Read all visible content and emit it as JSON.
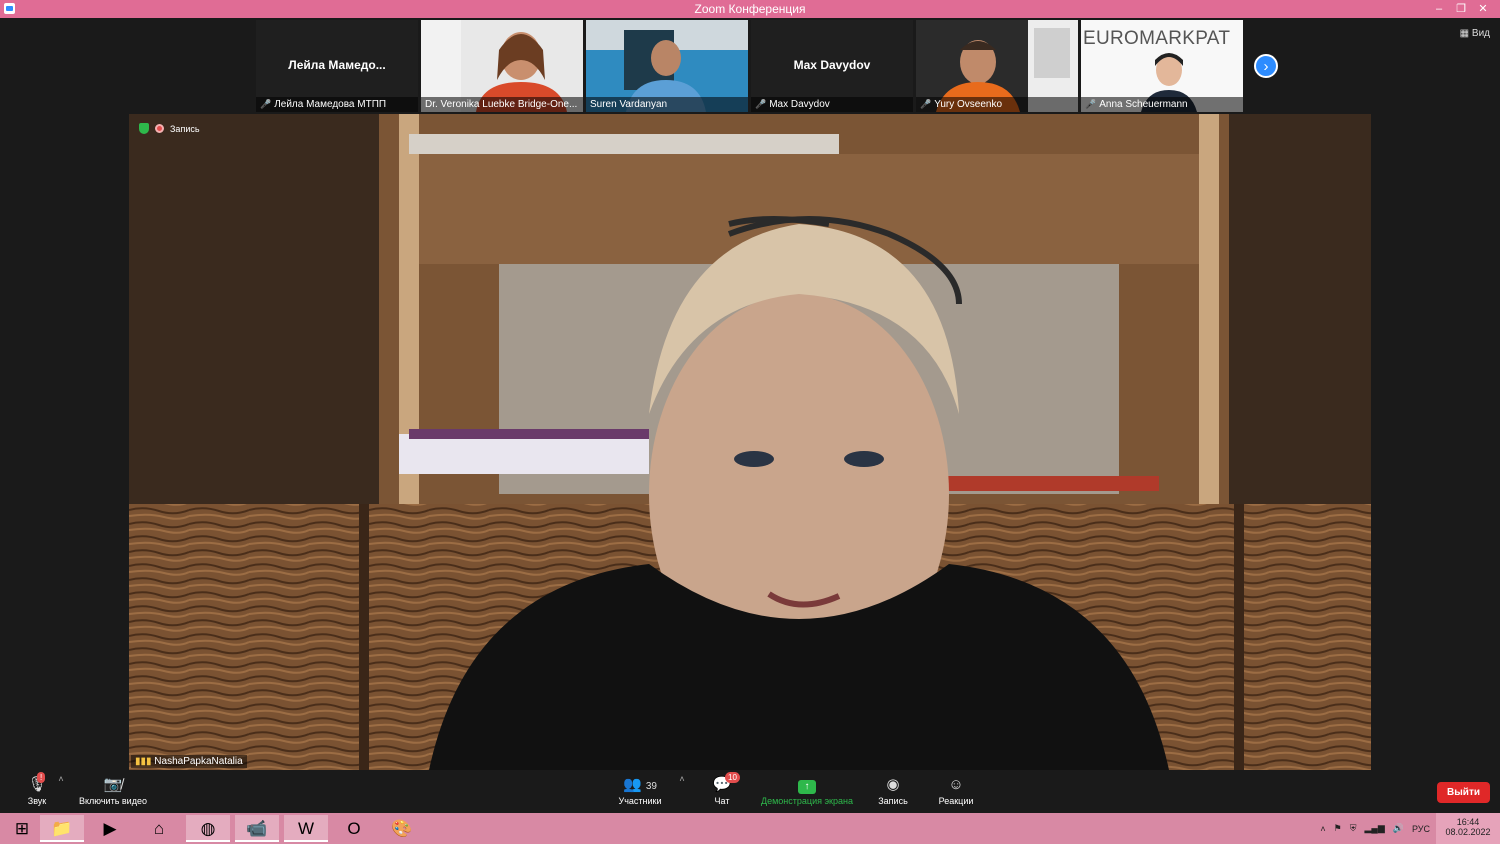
{
  "window": {
    "title": "Zoom Конференция",
    "min": "–",
    "restore": "❐",
    "close": "✕"
  },
  "view_button": "▦ Вид",
  "participants_strip": [
    {
      "display": "Лейла  Мамедо...",
      "label": "Лейла Мамедова МТПП",
      "muted": true,
      "video": false
    },
    {
      "label": "Dr. Veronika Luebke Bridge-One...",
      "muted": false,
      "video": true
    },
    {
      "label": "Suren Vardanyan",
      "muted": false,
      "video": true
    },
    {
      "display": "Max Davydov",
      "label": "Max Davydov",
      "muted": true,
      "video": false
    },
    {
      "label": "Yury Ovseenko",
      "muted": true,
      "video": true
    },
    {
      "logo_text": "EUROMARKPAT",
      "label": "Anna Scheuermann",
      "muted": true,
      "video": true
    }
  ],
  "main_video": {
    "recording_label": "Запись",
    "speaker_name": "NashaPapkaNatalia"
  },
  "toolbar": {
    "audio": "Звук",
    "video": "Включить видео",
    "participants": "Участники",
    "participants_count": "39",
    "chat": "Чат",
    "chat_badge": "10",
    "share": "Демонстрация экрана",
    "record": "Запись",
    "reactions": "Реакции",
    "leave": "Выйти"
  },
  "taskbar": {
    "lang": "РУС",
    "time": "16:44",
    "date": "08.02.2022"
  },
  "colors": {
    "titlebar": "#e06c95",
    "taskbar": "#d889a4",
    "accent": "#2d8cff",
    "share_green": "#2eb84b",
    "leave_red": "#e02828"
  }
}
